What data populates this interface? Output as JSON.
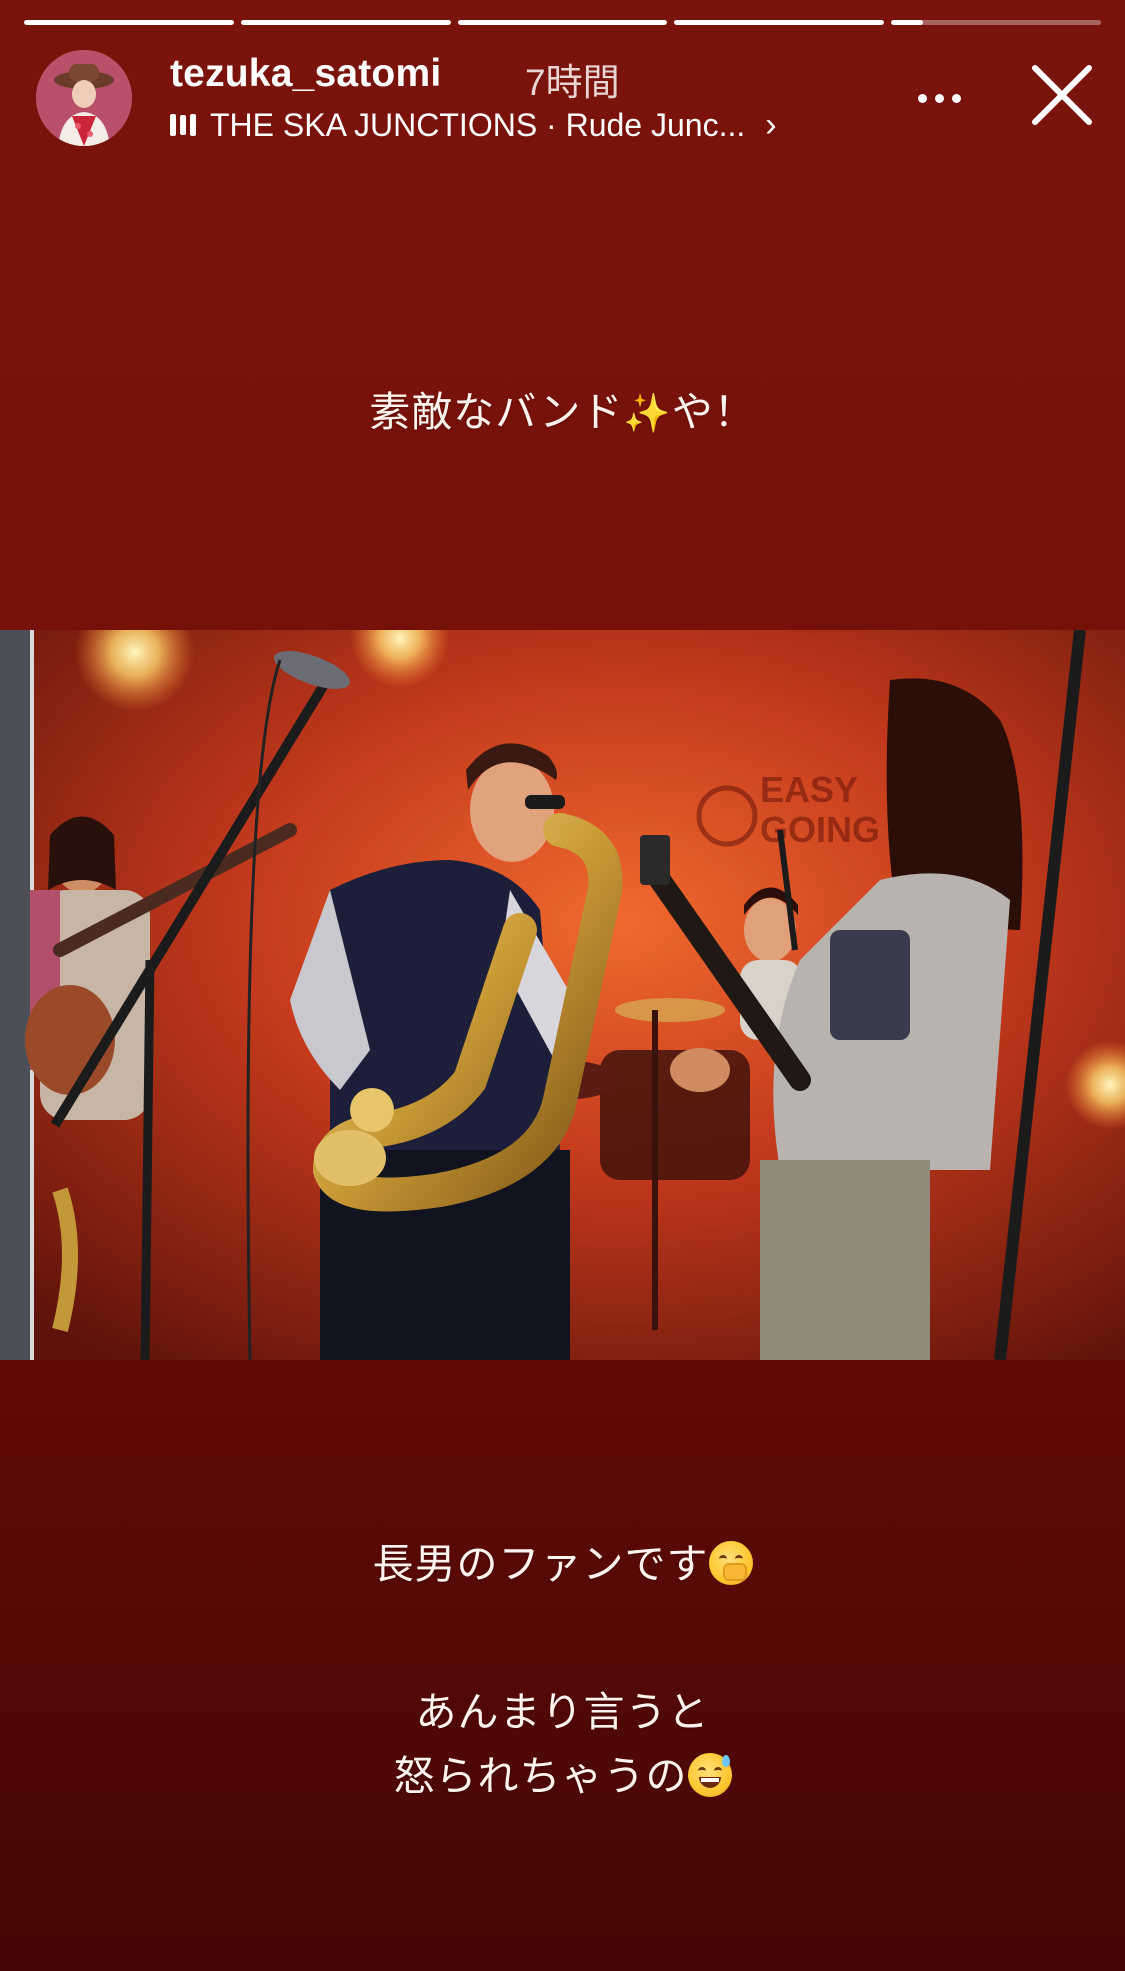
{
  "progress": {
    "segments": [
      1,
      1,
      1,
      1,
      0.15
    ]
  },
  "header": {
    "username": "tezuka_satomi",
    "time_ago": "7時間",
    "music_label": "THE SKA JUNCTIONS · Rude Junc...",
    "more_icon": "more-horizontal-icon",
    "close_icon": "close-icon"
  },
  "story": {
    "caption_top_text": "素敵なバンド",
    "caption_top_tail": "や！",
    "caption_middle": "長男のファンです",
    "caption_bottom_line1": "あんまり言うと",
    "caption_bottom_line2": "怒られちゃうの",
    "venue_sign": [
      "EASY",
      "GOING"
    ]
  },
  "colors": {
    "background": "#761109",
    "accent_text": "#fdf3ee"
  }
}
